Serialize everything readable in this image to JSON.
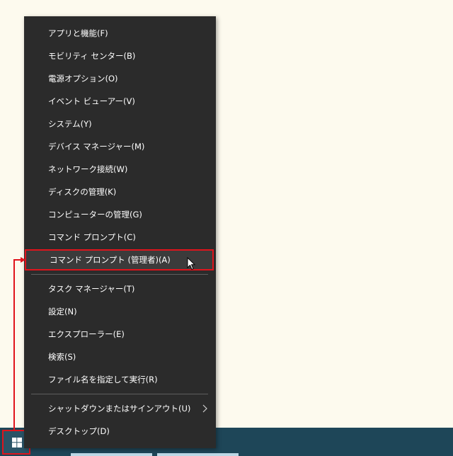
{
  "menu": {
    "items": [
      {
        "label": "アプリと機能(F)"
      },
      {
        "label": "モビリティ センター(B)"
      },
      {
        "label": "電源オプション(O)"
      },
      {
        "label": "イベント ビューアー(V)"
      },
      {
        "label": "システム(Y)"
      },
      {
        "label": "デバイス マネージャー(M)"
      },
      {
        "label": "ネットワーク接続(W)"
      },
      {
        "label": "ディスクの管理(K)"
      },
      {
        "label": "コンピューターの管理(G)"
      },
      {
        "label": "コマンド プロンプト(C)"
      },
      {
        "label": "コマンド プロンプト (管理者)(A)",
        "highlighted": true
      },
      {
        "label": "タスク マネージャー(T)"
      },
      {
        "label": "設定(N)"
      },
      {
        "label": "エクスプローラー(E)"
      },
      {
        "label": "検索(S)"
      },
      {
        "label": "ファイル名を指定して実行(R)"
      },
      {
        "label": "シャットダウンまたはサインアウト(U)",
        "submenu": true
      },
      {
        "label": "デスクトップ(D)"
      }
    ]
  },
  "icons": {
    "start": "windows-logo-icon",
    "submenu": "chevron-right-icon",
    "cursor": "mouse-pointer-icon"
  },
  "colors": {
    "desktop": "#fdfaee",
    "menu_background": "#2b2b2b",
    "menu_text": "#ffffff",
    "highlight_border": "#e0141c",
    "taskbar": "#1e4658"
  }
}
